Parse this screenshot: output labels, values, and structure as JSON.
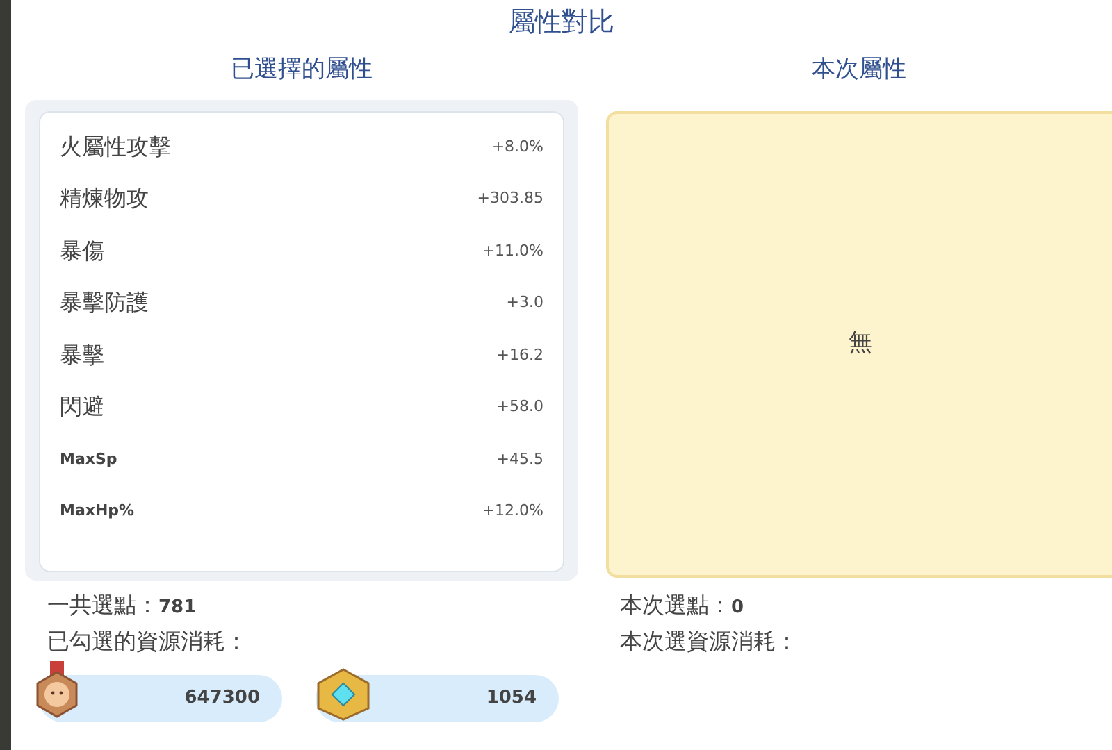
{
  "title": "屬性對比",
  "selected_panel": {
    "heading": "已選擇的屬性",
    "attributes": [
      {
        "name": "火屬性攻擊",
        "value": "+8.0%"
      },
      {
        "name": "精煉物攻",
        "value": "+303.85"
      },
      {
        "name": "暴傷",
        "value": "+11.0%"
      },
      {
        "name": "暴擊防護",
        "value": "+3.0"
      },
      {
        "name": "暴擊",
        "value": "+16.2"
      },
      {
        "name": "閃避",
        "value": "+58.0"
      },
      {
        "name": "MaxSp",
        "value": "+45.5"
      },
      {
        "name": "MaxHp%",
        "value": "+12.0%"
      }
    ],
    "points_label": "一共選點：",
    "points_value": "781",
    "cost_label": "已勾選的資源消耗：",
    "costs": [
      {
        "kind": "medal",
        "amount": "647300"
      },
      {
        "kind": "crystal",
        "amount": "1054"
      }
    ]
  },
  "current_panel": {
    "heading": "本次屬性",
    "empty_text": "無",
    "points_label": "本次選點：",
    "points_value": "0",
    "cost_label": "本次選資源消耗："
  }
}
